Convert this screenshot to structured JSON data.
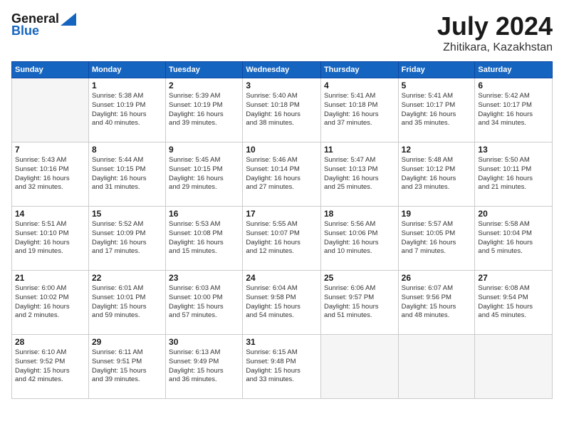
{
  "header": {
    "logo_general": "General",
    "logo_blue": "Blue",
    "title": "July 2024",
    "subtitle": "Zhitikara, Kazakhstan"
  },
  "days_of_week": [
    "Sunday",
    "Monday",
    "Tuesday",
    "Wednesday",
    "Thursday",
    "Friday",
    "Saturday"
  ],
  "weeks": [
    [
      {
        "day": "",
        "info": ""
      },
      {
        "day": "1",
        "info": "Sunrise: 5:38 AM\nSunset: 10:19 PM\nDaylight: 16 hours\nand 40 minutes."
      },
      {
        "day": "2",
        "info": "Sunrise: 5:39 AM\nSunset: 10:19 PM\nDaylight: 16 hours\nand 39 minutes."
      },
      {
        "day": "3",
        "info": "Sunrise: 5:40 AM\nSunset: 10:18 PM\nDaylight: 16 hours\nand 38 minutes."
      },
      {
        "day": "4",
        "info": "Sunrise: 5:41 AM\nSunset: 10:18 PM\nDaylight: 16 hours\nand 37 minutes."
      },
      {
        "day": "5",
        "info": "Sunrise: 5:41 AM\nSunset: 10:17 PM\nDaylight: 16 hours\nand 35 minutes."
      },
      {
        "day": "6",
        "info": "Sunrise: 5:42 AM\nSunset: 10:17 PM\nDaylight: 16 hours\nand 34 minutes."
      }
    ],
    [
      {
        "day": "7",
        "info": "Sunrise: 5:43 AM\nSunset: 10:16 PM\nDaylight: 16 hours\nand 32 minutes."
      },
      {
        "day": "8",
        "info": "Sunrise: 5:44 AM\nSunset: 10:15 PM\nDaylight: 16 hours\nand 31 minutes."
      },
      {
        "day": "9",
        "info": "Sunrise: 5:45 AM\nSunset: 10:15 PM\nDaylight: 16 hours\nand 29 minutes."
      },
      {
        "day": "10",
        "info": "Sunrise: 5:46 AM\nSunset: 10:14 PM\nDaylight: 16 hours\nand 27 minutes."
      },
      {
        "day": "11",
        "info": "Sunrise: 5:47 AM\nSunset: 10:13 PM\nDaylight: 16 hours\nand 25 minutes."
      },
      {
        "day": "12",
        "info": "Sunrise: 5:48 AM\nSunset: 10:12 PM\nDaylight: 16 hours\nand 23 minutes."
      },
      {
        "day": "13",
        "info": "Sunrise: 5:50 AM\nSunset: 10:11 PM\nDaylight: 16 hours\nand 21 minutes."
      }
    ],
    [
      {
        "day": "14",
        "info": "Sunrise: 5:51 AM\nSunset: 10:10 PM\nDaylight: 16 hours\nand 19 minutes."
      },
      {
        "day": "15",
        "info": "Sunrise: 5:52 AM\nSunset: 10:09 PM\nDaylight: 16 hours\nand 17 minutes."
      },
      {
        "day": "16",
        "info": "Sunrise: 5:53 AM\nSunset: 10:08 PM\nDaylight: 16 hours\nand 15 minutes."
      },
      {
        "day": "17",
        "info": "Sunrise: 5:55 AM\nSunset: 10:07 PM\nDaylight: 16 hours\nand 12 minutes."
      },
      {
        "day": "18",
        "info": "Sunrise: 5:56 AM\nSunset: 10:06 PM\nDaylight: 16 hours\nand 10 minutes."
      },
      {
        "day": "19",
        "info": "Sunrise: 5:57 AM\nSunset: 10:05 PM\nDaylight: 16 hours\nand 7 minutes."
      },
      {
        "day": "20",
        "info": "Sunrise: 5:58 AM\nSunset: 10:04 PM\nDaylight: 16 hours\nand 5 minutes."
      }
    ],
    [
      {
        "day": "21",
        "info": "Sunrise: 6:00 AM\nSunset: 10:02 PM\nDaylight: 16 hours\nand 2 minutes."
      },
      {
        "day": "22",
        "info": "Sunrise: 6:01 AM\nSunset: 10:01 PM\nDaylight: 15 hours\nand 59 minutes."
      },
      {
        "day": "23",
        "info": "Sunrise: 6:03 AM\nSunset: 10:00 PM\nDaylight: 15 hours\nand 57 minutes."
      },
      {
        "day": "24",
        "info": "Sunrise: 6:04 AM\nSunset: 9:58 PM\nDaylight: 15 hours\nand 54 minutes."
      },
      {
        "day": "25",
        "info": "Sunrise: 6:06 AM\nSunset: 9:57 PM\nDaylight: 15 hours\nand 51 minutes."
      },
      {
        "day": "26",
        "info": "Sunrise: 6:07 AM\nSunset: 9:56 PM\nDaylight: 15 hours\nand 48 minutes."
      },
      {
        "day": "27",
        "info": "Sunrise: 6:08 AM\nSunset: 9:54 PM\nDaylight: 15 hours\nand 45 minutes."
      }
    ],
    [
      {
        "day": "28",
        "info": "Sunrise: 6:10 AM\nSunset: 9:52 PM\nDaylight: 15 hours\nand 42 minutes."
      },
      {
        "day": "29",
        "info": "Sunrise: 6:11 AM\nSunset: 9:51 PM\nDaylight: 15 hours\nand 39 minutes."
      },
      {
        "day": "30",
        "info": "Sunrise: 6:13 AM\nSunset: 9:49 PM\nDaylight: 15 hours\nand 36 minutes."
      },
      {
        "day": "31",
        "info": "Sunrise: 6:15 AM\nSunset: 9:48 PM\nDaylight: 15 hours\nand 33 minutes."
      },
      {
        "day": "",
        "info": ""
      },
      {
        "day": "",
        "info": ""
      },
      {
        "day": "",
        "info": ""
      }
    ]
  ]
}
